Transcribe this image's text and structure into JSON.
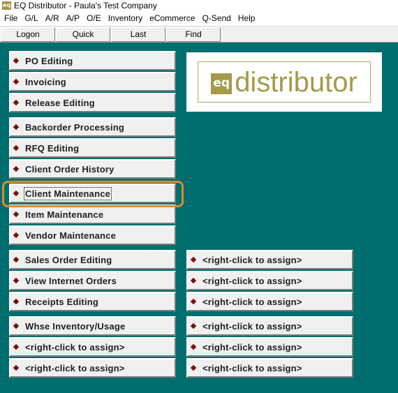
{
  "window": {
    "title": "EQ Distributor - Paula's Test Company",
    "app_icon": "eq-app-icon"
  },
  "menubar": {
    "items": [
      {
        "name": "menu-file",
        "label": "File"
      },
      {
        "name": "menu-gl",
        "label": "G/L"
      },
      {
        "name": "menu-ar",
        "label": "A/R"
      },
      {
        "name": "menu-ap",
        "label": "A/P"
      },
      {
        "name": "menu-oe",
        "label": "O/E"
      },
      {
        "name": "menu-inventory",
        "label": "Inventory"
      },
      {
        "name": "menu-ecommerce",
        "label": "eCommerce"
      },
      {
        "name": "menu-qsend",
        "label": "Q-Send"
      },
      {
        "name": "menu-help",
        "label": "Help"
      }
    ]
  },
  "toolbar": {
    "logon": "Logon",
    "quick": "Quick",
    "last": "Last",
    "find": "Find"
  },
  "logo": {
    "mark": "eq",
    "text": "distributor",
    "color": "#a59a4a"
  },
  "left_buttons": [
    "PO Editing",
    "Invoicing",
    "Release Editing",
    "Backorder Processing",
    "RFQ Editing",
    "Client Order History",
    "Client Maintenance",
    "Item Maintenance",
    "Vendor Maintenance",
    "Sales Order Editing",
    "View Internet Orders",
    "Receipts Editing",
    "Whse Inventory/Usage",
    "<right-click to assign>",
    "<right-click to assign>"
  ],
  "right_buttons": [
    "<right-click to assign>",
    "<right-click to assign>",
    "<right-click to assign>",
    "<right-click to assign>",
    "<right-click to assign>",
    "<right-click to assign>"
  ],
  "colors": {
    "background": "#006e6e",
    "bullet": "#7a1010",
    "highlight": "#e08a2a"
  }
}
